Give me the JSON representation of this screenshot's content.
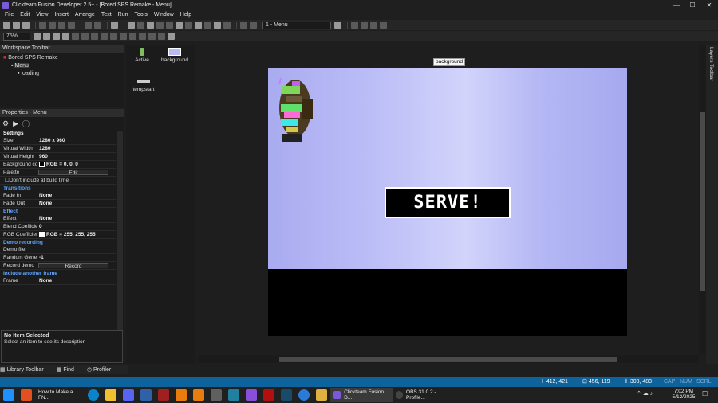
{
  "window": {
    "title": "Clickteam Fusion Developer 2.5+ - [Bored SPS Remake - Menu]",
    "minimize": "—",
    "maximize": "☐",
    "close": "✕"
  },
  "menu": [
    "File",
    "Edit",
    "View",
    "Insert",
    "Arrange",
    "Text",
    "Run",
    "Tools",
    "Window",
    "Help"
  ],
  "toolbar": {
    "zoom": "75%",
    "frame_select": "1 - Menu"
  },
  "workspace": {
    "title": "Workspace Toolbar",
    "tree": [
      "Bored SPS Remake",
      "Menu",
      "loading"
    ]
  },
  "properties": {
    "title": "Properties - Menu",
    "sections": {
      "settings": "Settings",
      "transitions": "Transitions",
      "effect": "Effect",
      "demo": "Demo recording",
      "include": "Include another frame"
    },
    "rows": {
      "size": {
        "k": "Size",
        "v": "1280 x 960"
      },
      "vwidth": {
        "k": "Virtual Width",
        "v": "1280"
      },
      "vheight": {
        "k": "Virtual Height",
        "v": "960"
      },
      "bgcolor": {
        "k": "Background co",
        "v": "RGB = 0, 0, 0"
      },
      "palette": {
        "k": "Palette",
        "v": "Edit"
      },
      "dontinclude": "Don't include at build time",
      "fadein": {
        "k": "Fade In",
        "v": "None"
      },
      "fadeout": {
        "k": "Fade Out",
        "v": "None"
      },
      "effect": {
        "k": "Effect",
        "v": "None"
      },
      "blend": {
        "k": "Blend Coefficie",
        "v": "0"
      },
      "rgbcoef": {
        "k": "RGB Coefficien",
        "v": "RGB = 255, 255, 255"
      },
      "demofile": {
        "k": "Demo file",
        "v": ""
      },
      "randgen": {
        "k": "Random Gener",
        "v": "-1"
      },
      "recorddemo": {
        "k": "Record demo",
        "v": "Record"
      },
      "frame": {
        "k": "Frame",
        "v": "None"
      }
    },
    "desc_title": "No Item Selected",
    "desc_text": "Select an item to see its description"
  },
  "objects": [
    {
      "label": "Active"
    },
    {
      "label": "background"
    },
    {
      "label": "tempstart"
    }
  ],
  "editor": {
    "tooltip": "background",
    "serve": "SERVE!"
  },
  "layers_label": "Layers Toolbar",
  "bottom_tabs": [
    "Library Toolbar",
    "Find",
    "Profiler"
  ],
  "status": {
    "coord1": "412, 421",
    "coord2": "456, 119",
    "coord3": "308, 483",
    "cap": "CAP",
    "num": "NUM",
    "scrl": "SCRL"
  },
  "taskbar": {
    "items": [
      "How to Make a FN...",
      "Clickteam Fusion D...",
      "OBS 31.0.2 - Profile..."
    ],
    "time": "7:02 PM",
    "date": "5/12/2025"
  }
}
